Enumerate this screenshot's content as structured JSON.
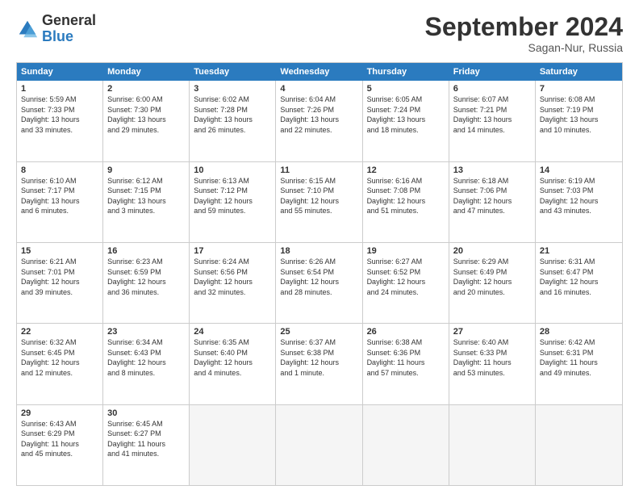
{
  "logo": {
    "general": "General",
    "blue": "Blue"
  },
  "title": "September 2024",
  "location": "Sagan-Nur, Russia",
  "header_days": [
    "Sunday",
    "Monday",
    "Tuesday",
    "Wednesday",
    "Thursday",
    "Friday",
    "Saturday"
  ],
  "weeks": [
    [
      {
        "day": "1",
        "lines": [
          "Sunrise: 5:59 AM",
          "Sunset: 7:33 PM",
          "Daylight: 13 hours",
          "and 33 minutes."
        ]
      },
      {
        "day": "2",
        "lines": [
          "Sunrise: 6:00 AM",
          "Sunset: 7:30 PM",
          "Daylight: 13 hours",
          "and 29 minutes."
        ]
      },
      {
        "day": "3",
        "lines": [
          "Sunrise: 6:02 AM",
          "Sunset: 7:28 PM",
          "Daylight: 13 hours",
          "and 26 minutes."
        ]
      },
      {
        "day": "4",
        "lines": [
          "Sunrise: 6:04 AM",
          "Sunset: 7:26 PM",
          "Daylight: 13 hours",
          "and 22 minutes."
        ]
      },
      {
        "day": "5",
        "lines": [
          "Sunrise: 6:05 AM",
          "Sunset: 7:24 PM",
          "Daylight: 13 hours",
          "and 18 minutes."
        ]
      },
      {
        "day": "6",
        "lines": [
          "Sunrise: 6:07 AM",
          "Sunset: 7:21 PM",
          "Daylight: 13 hours",
          "and 14 minutes."
        ]
      },
      {
        "day": "7",
        "lines": [
          "Sunrise: 6:08 AM",
          "Sunset: 7:19 PM",
          "Daylight: 13 hours",
          "and 10 minutes."
        ]
      }
    ],
    [
      {
        "day": "8",
        "lines": [
          "Sunrise: 6:10 AM",
          "Sunset: 7:17 PM",
          "Daylight: 13 hours",
          "and 6 minutes."
        ]
      },
      {
        "day": "9",
        "lines": [
          "Sunrise: 6:12 AM",
          "Sunset: 7:15 PM",
          "Daylight: 13 hours",
          "and 3 minutes."
        ]
      },
      {
        "day": "10",
        "lines": [
          "Sunrise: 6:13 AM",
          "Sunset: 7:12 PM",
          "Daylight: 12 hours",
          "and 59 minutes."
        ]
      },
      {
        "day": "11",
        "lines": [
          "Sunrise: 6:15 AM",
          "Sunset: 7:10 PM",
          "Daylight: 12 hours",
          "and 55 minutes."
        ]
      },
      {
        "day": "12",
        "lines": [
          "Sunrise: 6:16 AM",
          "Sunset: 7:08 PM",
          "Daylight: 12 hours",
          "and 51 minutes."
        ]
      },
      {
        "day": "13",
        "lines": [
          "Sunrise: 6:18 AM",
          "Sunset: 7:06 PM",
          "Daylight: 12 hours",
          "and 47 minutes."
        ]
      },
      {
        "day": "14",
        "lines": [
          "Sunrise: 6:19 AM",
          "Sunset: 7:03 PM",
          "Daylight: 12 hours",
          "and 43 minutes."
        ]
      }
    ],
    [
      {
        "day": "15",
        "lines": [
          "Sunrise: 6:21 AM",
          "Sunset: 7:01 PM",
          "Daylight: 12 hours",
          "and 39 minutes."
        ]
      },
      {
        "day": "16",
        "lines": [
          "Sunrise: 6:23 AM",
          "Sunset: 6:59 PM",
          "Daylight: 12 hours",
          "and 36 minutes."
        ]
      },
      {
        "day": "17",
        "lines": [
          "Sunrise: 6:24 AM",
          "Sunset: 6:56 PM",
          "Daylight: 12 hours",
          "and 32 minutes."
        ]
      },
      {
        "day": "18",
        "lines": [
          "Sunrise: 6:26 AM",
          "Sunset: 6:54 PM",
          "Daylight: 12 hours",
          "and 28 minutes."
        ]
      },
      {
        "day": "19",
        "lines": [
          "Sunrise: 6:27 AM",
          "Sunset: 6:52 PM",
          "Daylight: 12 hours",
          "and 24 minutes."
        ]
      },
      {
        "day": "20",
        "lines": [
          "Sunrise: 6:29 AM",
          "Sunset: 6:49 PM",
          "Daylight: 12 hours",
          "and 20 minutes."
        ]
      },
      {
        "day": "21",
        "lines": [
          "Sunrise: 6:31 AM",
          "Sunset: 6:47 PM",
          "Daylight: 12 hours",
          "and 16 minutes."
        ]
      }
    ],
    [
      {
        "day": "22",
        "lines": [
          "Sunrise: 6:32 AM",
          "Sunset: 6:45 PM",
          "Daylight: 12 hours",
          "and 12 minutes."
        ]
      },
      {
        "day": "23",
        "lines": [
          "Sunrise: 6:34 AM",
          "Sunset: 6:43 PM",
          "Daylight: 12 hours",
          "and 8 minutes."
        ]
      },
      {
        "day": "24",
        "lines": [
          "Sunrise: 6:35 AM",
          "Sunset: 6:40 PM",
          "Daylight: 12 hours",
          "and 4 minutes."
        ]
      },
      {
        "day": "25",
        "lines": [
          "Sunrise: 6:37 AM",
          "Sunset: 6:38 PM",
          "Daylight: 12 hours",
          "and 1 minute."
        ]
      },
      {
        "day": "26",
        "lines": [
          "Sunrise: 6:38 AM",
          "Sunset: 6:36 PM",
          "Daylight: 11 hours",
          "and 57 minutes."
        ]
      },
      {
        "day": "27",
        "lines": [
          "Sunrise: 6:40 AM",
          "Sunset: 6:33 PM",
          "Daylight: 11 hours",
          "and 53 minutes."
        ]
      },
      {
        "day": "28",
        "lines": [
          "Sunrise: 6:42 AM",
          "Sunset: 6:31 PM",
          "Daylight: 11 hours",
          "and 49 minutes."
        ]
      }
    ],
    [
      {
        "day": "29",
        "lines": [
          "Sunrise: 6:43 AM",
          "Sunset: 6:29 PM",
          "Daylight: 11 hours",
          "and 45 minutes."
        ]
      },
      {
        "day": "30",
        "lines": [
          "Sunrise: 6:45 AM",
          "Sunset: 6:27 PM",
          "Daylight: 11 hours",
          "and 41 minutes."
        ]
      },
      {
        "day": "",
        "lines": []
      },
      {
        "day": "",
        "lines": []
      },
      {
        "day": "",
        "lines": []
      },
      {
        "day": "",
        "lines": []
      },
      {
        "day": "",
        "lines": []
      }
    ]
  ]
}
